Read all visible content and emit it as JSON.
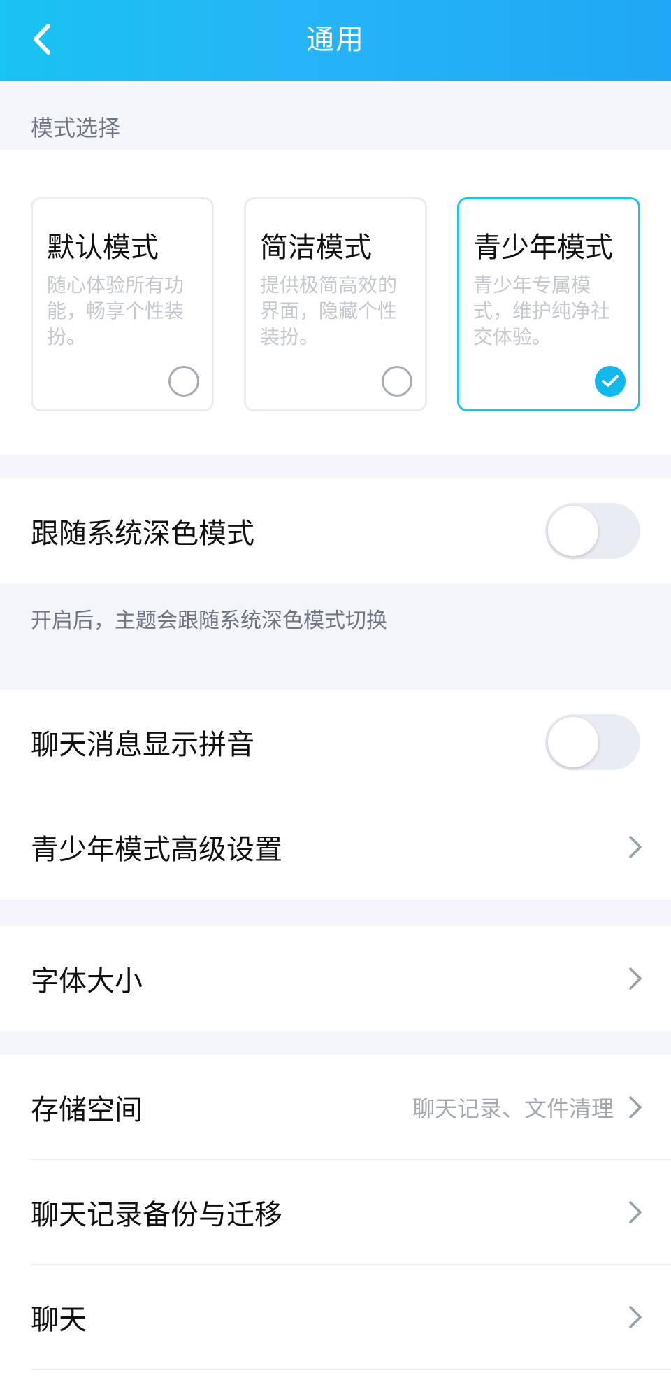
{
  "header": {
    "title": "通用",
    "back_icon": "chevron-left-icon"
  },
  "mode_section": {
    "label": "模式选择",
    "cards": [
      {
        "title": "默认模式",
        "desc": "随心体验所有功能，畅享个性装扮。",
        "selected": false
      },
      {
        "title": "简洁模式",
        "desc": "提供极简高效的界面，隐藏个性装扮。",
        "selected": false
      },
      {
        "title": "青少年模式",
        "desc": "青少年专属模式，维护纯净社交体验。",
        "selected": true
      }
    ]
  },
  "dark_mode": {
    "label": "跟随系统深色模式",
    "enabled": false,
    "hint": "开启后，主题会跟随系统深色模式切换"
  },
  "chat_pinyin": {
    "label": "聊天消息显示拼音",
    "enabled": false
  },
  "teen_advanced": {
    "label": "青少年模式高级设置"
  },
  "font_size": {
    "label": "字体大小"
  },
  "storage": {
    "label": "存储空间",
    "sub": "聊天记录、文件清理"
  },
  "backup": {
    "label": "聊天记录备份与迁移"
  },
  "chat": {
    "label": "聊天"
  },
  "colors": {
    "accent": "#1ec3e8",
    "header_start": "#19c3f2",
    "header_end": "#1fa7f5",
    "check_fill": "#12b7ec"
  }
}
